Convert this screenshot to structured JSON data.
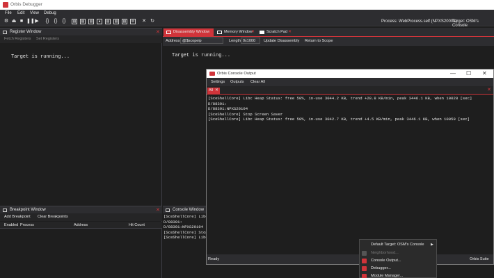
{
  "window": {
    "title": "Orbis Debugger"
  },
  "menu": [
    "File",
    "Edit",
    "View",
    "Debug"
  ],
  "toolbar": {
    "icons": [
      "connect-icon",
      "eject-icon",
      "stop-icon",
      "pause-icon",
      "play-icon",
      "step-into-icon",
      "step-over-icon",
      "step-out-icon"
    ],
    "process_label": "Process: WebProcess.self (NPXS20001)",
    "target_label": "Target: OSM's Console"
  },
  "register_window": {
    "title": "Register Window",
    "fetch_label": "Fetch Registers",
    "set_label": "Set Registers",
    "body": "Target is running..."
  },
  "breakpoint_window": {
    "title": "Breakpoint Window",
    "add_label": "Add Breakpoint",
    "clear_label": "Clear Breakpoints",
    "columns": [
      "Enabled",
      "Process",
      "Address",
      "Hit Count"
    ]
  },
  "tabs": [
    {
      "label": "Disassembly Window"
    },
    {
      "label": "Memory Window"
    },
    {
      "label": "Scratch Pad"
    }
  ],
  "disassembly": {
    "address_label": "Address",
    "address_value": "@$scopeip",
    "length_label": "Length",
    "length_value": "0x1000",
    "update_label": "Update Disassembly",
    "return_label": "Return to Scope",
    "body": "Target is running..."
  },
  "console_window": {
    "title": "Console Window",
    "lines": [
      "[SceShellCore] Libc",
      "D/88391:",
      "D/88391:NPXS20104",
      "[SceShellCore] Stop",
      "[SceShellCore] Libc"
    ]
  },
  "console_output": {
    "title": "Orbis Console Output",
    "menu": [
      "Settings",
      "Outputs",
      "Clear All"
    ],
    "tab_label": "All",
    "lines": [
      "[SceShellCore] Libc Heap Status: free 50%, in-use 3044.2 KB, trend +28.8 KB/min, peak 3446.1 KB, when 10028 [sec]",
      "D/88391:",
      "D/88391:NPXS20104",
      "[SceShellCore] Stop Screen Saver",
      "[SceShellCore] Libc Heap Status: free 50%, in-use 3042.7 KB, trend +4.5 KB/min, peak 3446.1 KB, when 10059 [sec]"
    ],
    "status": "Ready",
    "status_right": "Orbis Suite"
  },
  "context_menu": {
    "items": [
      {
        "label": "Default Target: OSM's Console",
        "has_submenu": true
      },
      {
        "label": "Neighborhood...",
        "disabled": true
      },
      {
        "label": "Console Output..."
      },
      {
        "label": "Debugger..."
      },
      {
        "label": "Module Manager..."
      }
    ]
  },
  "colors": {
    "accent": "#d0343a",
    "bg": "#1e1e1e",
    "panel": "#2d2d30"
  }
}
